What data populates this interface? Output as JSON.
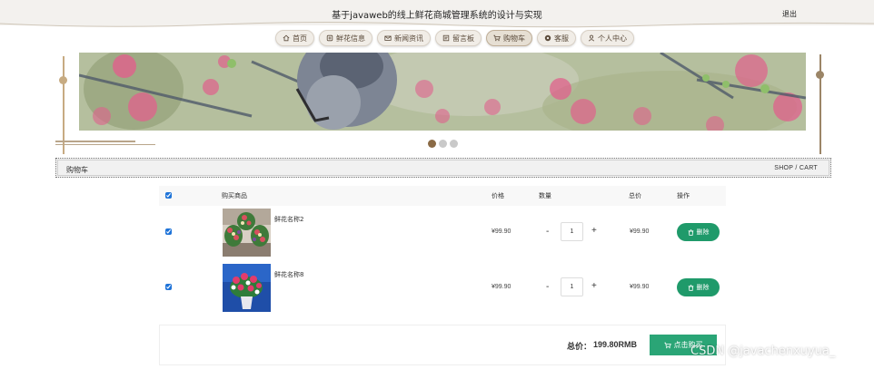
{
  "header": {
    "title": "基于javaweb的线上鲜花商城管理系统的设计与实现",
    "logout_label": "退出"
  },
  "nav": {
    "items": [
      {
        "label": "首页",
        "icon": "home-icon"
      },
      {
        "label": "鲜花信息",
        "icon": "flower-icon"
      },
      {
        "label": "新闻资讯",
        "icon": "mail-icon"
      },
      {
        "label": "留言板",
        "icon": "board-icon"
      },
      {
        "label": "购物车",
        "icon": "cart-icon",
        "active": true
      },
      {
        "label": "客服",
        "icon": "service-icon"
      },
      {
        "label": "个人中心",
        "icon": "user-icon"
      }
    ]
  },
  "carousel": {
    "slide_count": 3,
    "active_index": 0
  },
  "breadcrumb": {
    "left": "购物车",
    "right": "SHOP / CART"
  },
  "cart": {
    "columns": {
      "product": "购买商品",
      "price": "价格",
      "quantity": "数量",
      "total": "总价",
      "action": "操作"
    },
    "select_all": true,
    "items": [
      {
        "name": "鲜花名称2",
        "price": "¥99.90",
        "quantity": "1",
        "total": "¥99.90",
        "checked": true,
        "delete_label": "删除"
      },
      {
        "name": "鲜花名称8",
        "price": "¥99.90",
        "quantity": "1",
        "total": "¥99.90",
        "checked": true,
        "delete_label": "删除"
      }
    ],
    "minus_label": "-",
    "plus_label": "+"
  },
  "summary": {
    "total_label": "总价：",
    "total_value": "199.80RMB",
    "checkout_label": "点击购买"
  },
  "watermark": "CSDN @javachenxuyua_",
  "colors": {
    "accent_green": "#1f9a6a",
    "nav_bg": "#f1ede7",
    "deco_gold": "#c7ab82",
    "dot_active": "#8a6a45"
  }
}
